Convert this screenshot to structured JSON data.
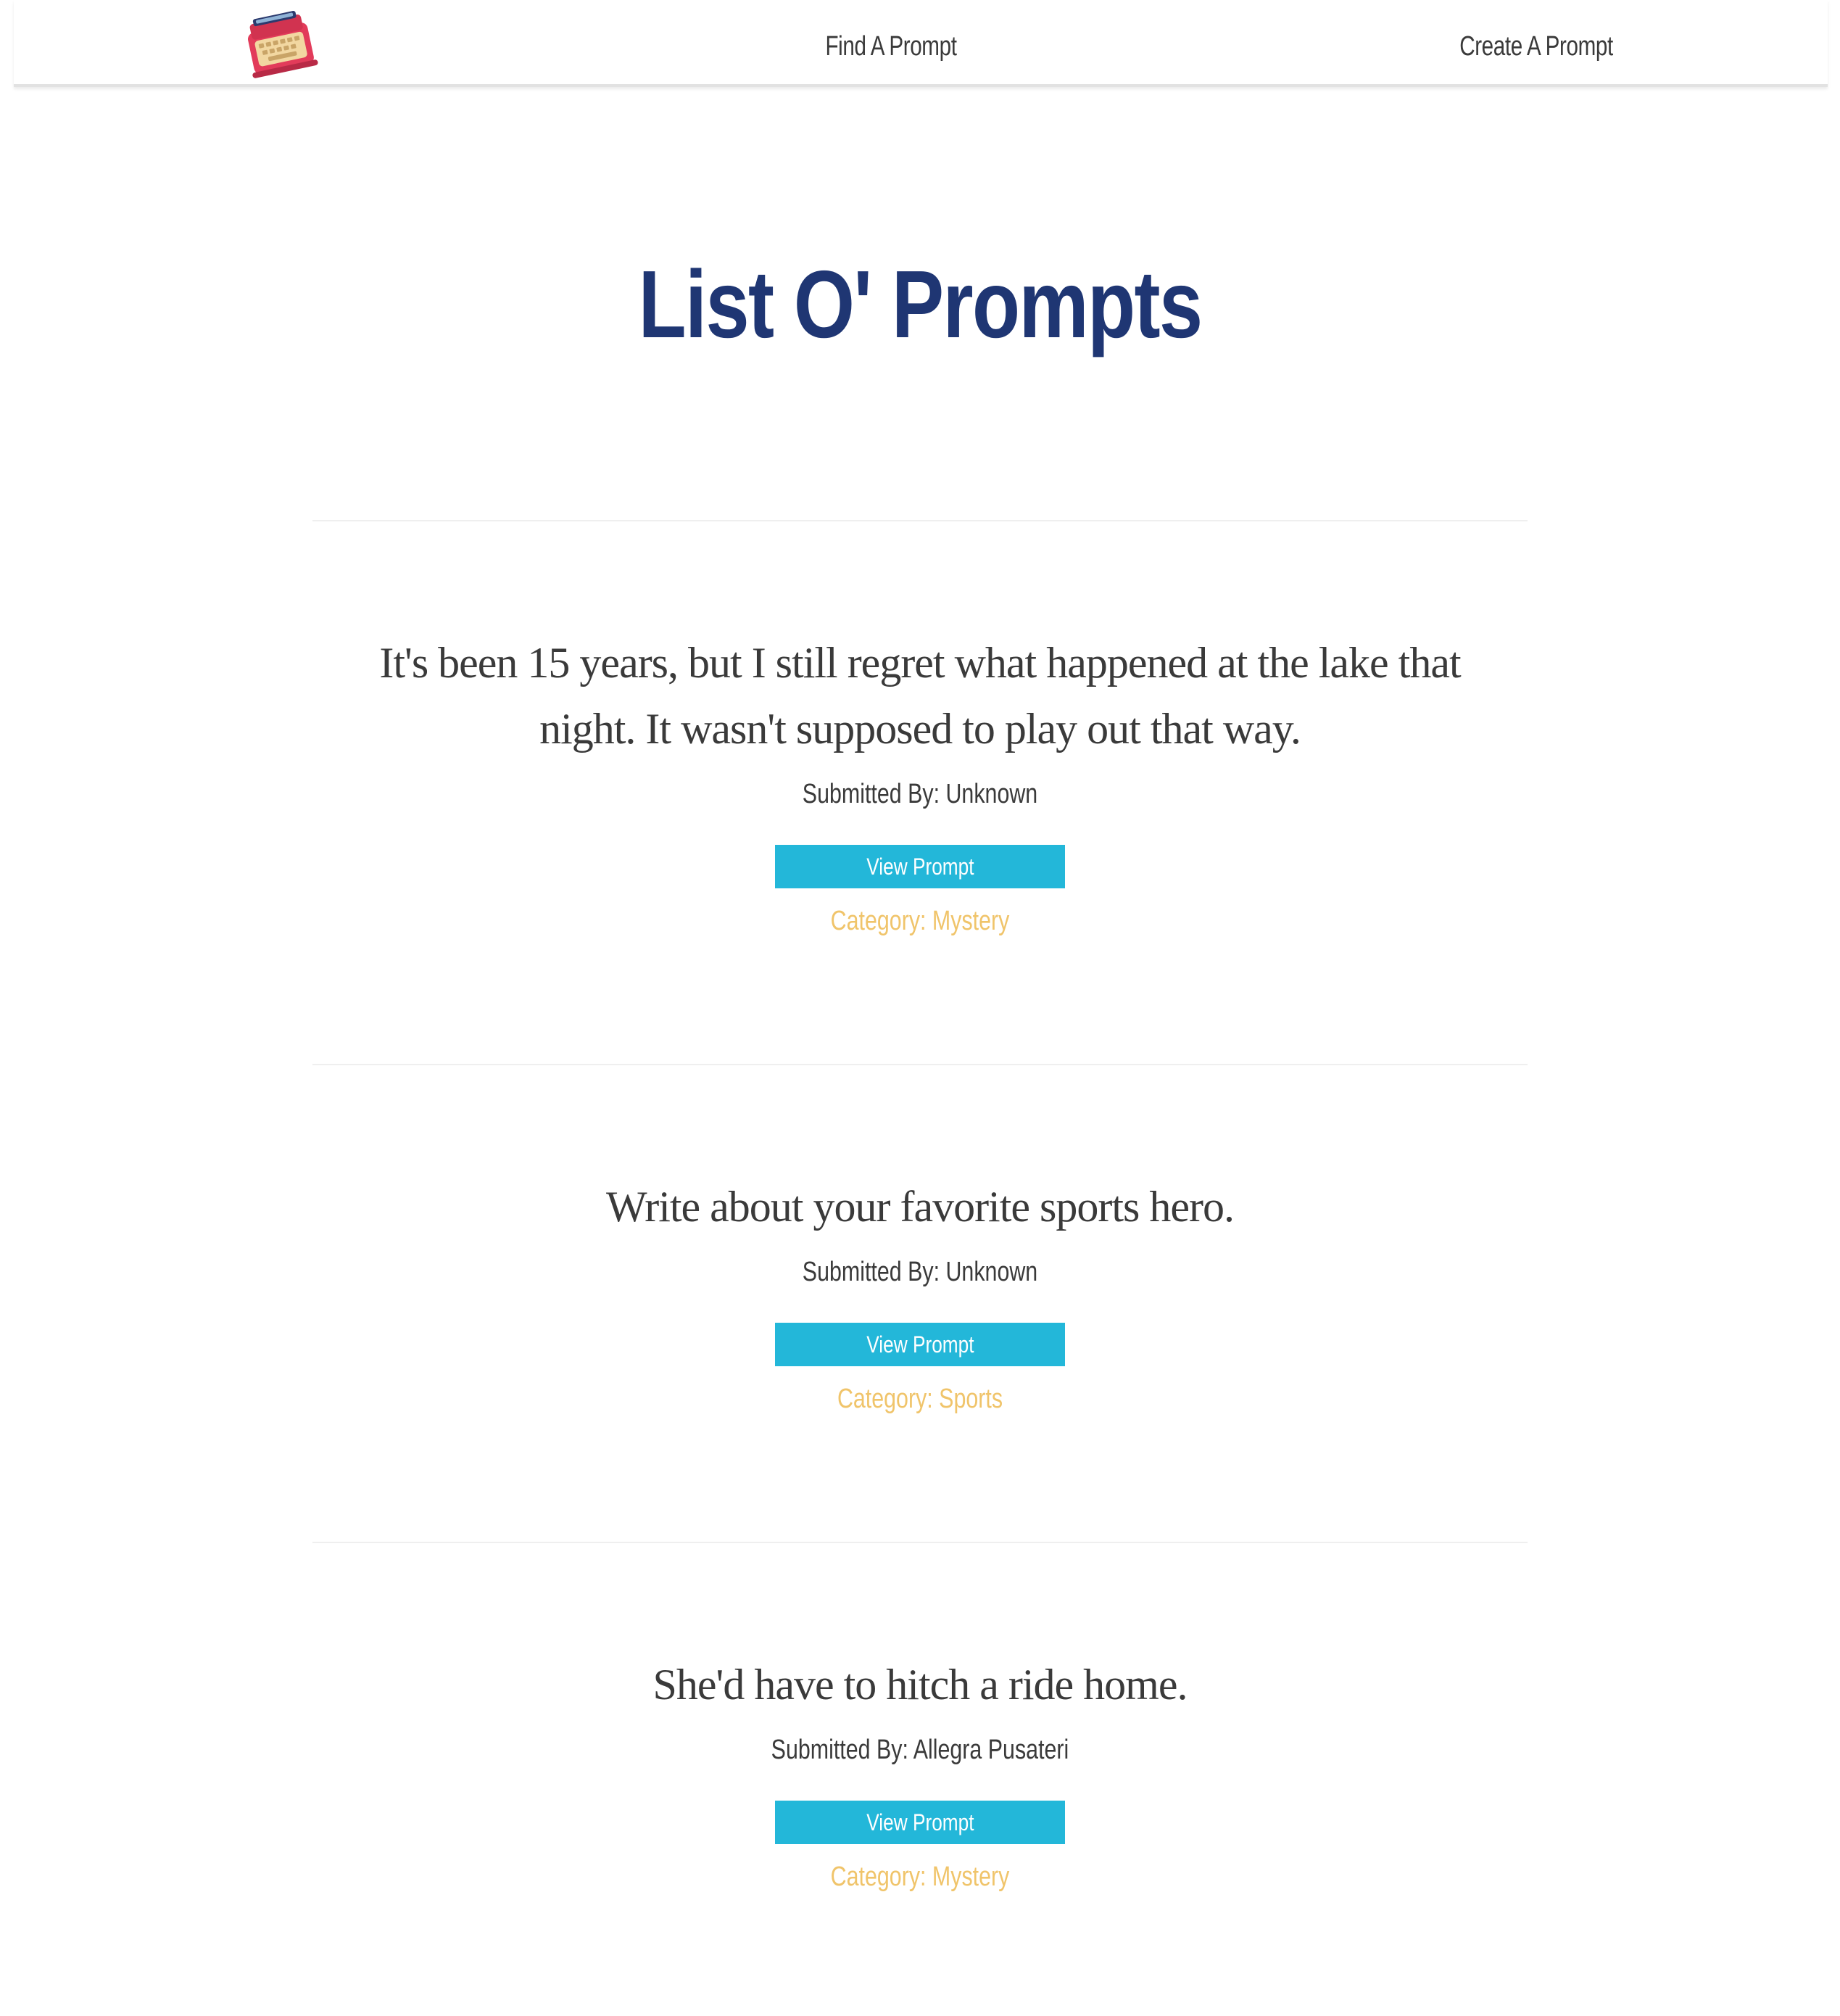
{
  "nav": {
    "logo_icon": "typewriter-logo",
    "links": [
      {
        "label": "Find A Prompt"
      },
      {
        "label": "Create A Prompt"
      }
    ]
  },
  "page": {
    "title": "List O' Prompts"
  },
  "prompts": [
    {
      "text": "It's been 15 years, but I still regret what happened at the lake that night. It wasn't supposed to play out that way.",
      "submitted_by": "Submitted By: Unknown",
      "button_label": "View Prompt",
      "category": "Category: Mystery"
    },
    {
      "text": "Write about your favorite sports hero.",
      "submitted_by": "Submitted By: Unknown",
      "button_label": "View Prompt",
      "category": "Category: Sports"
    },
    {
      "text": "She'd have to hitch a ride home.",
      "submitted_by": "Submitted By: Allegra Pusateri",
      "button_label": "View Prompt",
      "category": "Category: Mystery"
    }
  ],
  "colors": {
    "title": "#1f3673",
    "button": "#23b7d9",
    "category": "#f0c46a",
    "text": "#3a3a3a"
  }
}
